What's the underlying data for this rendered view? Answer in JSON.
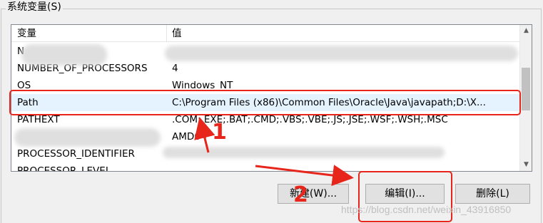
{
  "group": {
    "title": "系统变量(S)"
  },
  "list": {
    "headers": {
      "name": "变量",
      "value": "值"
    },
    "rows": [
      {
        "name": "N",
        "value": ""
      },
      {
        "name": "NUMBER_OF_PROCESSORS",
        "value": "4"
      },
      {
        "name": "OS",
        "value": "Windows_NT"
      },
      {
        "name": "Path",
        "value": "C:\\Program Files (x86)\\Common Files\\Oracle\\Java\\javapath;D:\\X..."
      },
      {
        "name": "PATHEXT",
        "value": ".COM;.EXE;.BAT;.CMD;.VBS;.VBE;.JS;.JSE;.WSF;.WSH;.MSC"
      },
      {
        "name": "",
        "value": "AMD64"
      },
      {
        "name": "PROCESSOR_IDENTIFIER",
        "value": ""
      },
      {
        "name": "PROCESSOR_LEVEL",
        "value": ""
      }
    ],
    "selected_row": "Path"
  },
  "buttons": {
    "new_label": "新建(W)...",
    "edit_label": "编辑(I)...",
    "delete_label": "删除(L)"
  },
  "annotations": {
    "step1": "1",
    "step2": "2",
    "color": "#e8251b"
  },
  "watermark": "https://blog.csdn.net/weixin_43916850",
  "icons": {
    "scroll_up": "chevron-up-icon",
    "scroll_down": "chevron-down-icon"
  }
}
